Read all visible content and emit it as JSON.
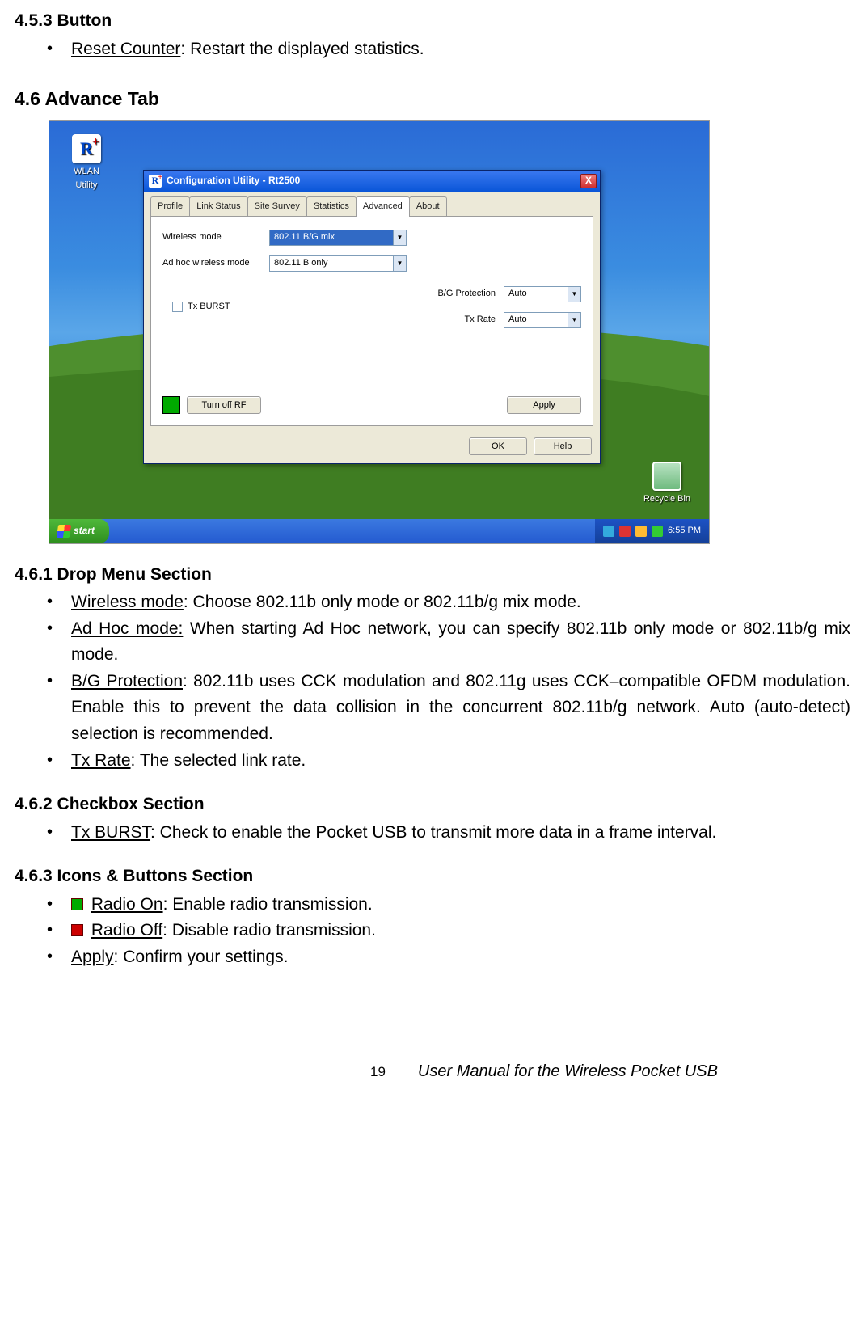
{
  "section_453": "4.5.3 Button",
  "bullet_453": {
    "term": "Reset Counter",
    "desc": ": Restart the displayed statistics."
  },
  "section_46": "4.6 Advance Tab",
  "desktop": {
    "shortcut_label": "WLAN Utility",
    "recycle_label": "Recycle Bin",
    "start_label": "start",
    "clock": "6:55 PM"
  },
  "dialog": {
    "title": "Configuration Utility - Rt2500",
    "close_glyph": "X",
    "tabs": [
      "Profile",
      "Link Status",
      "Site Survey",
      "Statistics",
      "Advanced",
      "About"
    ],
    "active_tab": "Advanced",
    "wireless_mode_label": "Wireless mode",
    "wireless_mode_value": "802.11 B/G mix",
    "adhoc_label": "Ad hoc wireless mode",
    "adhoc_value": "802.11 B only",
    "txburst_label": "Tx BURST",
    "bg_label": "B/G Protection",
    "bg_value": "Auto",
    "txrate_label": "Tx Rate",
    "txrate_value": "Auto",
    "turn_off_rf": "Turn off RF",
    "apply": "Apply",
    "ok": "OK",
    "help": "Help",
    "combo_arrow": "▼"
  },
  "section_461": "4.6.1 Drop Menu Section",
  "b461": {
    "wm_term": "Wireless mode",
    "wm_desc": ": Choose 802.11b only mode or 802.11b/g mix mode.",
    "ah_term": "Ad Hoc mode:",
    "ah_desc": " When starting Ad Hoc network, you can specify 802.11b only mode or 802.11b/g mix mode.",
    "bg_term": "B/G Protection",
    "bg_desc": ": 802.11b uses CCK modulation and 802.11g uses CCK–compatible OFDM modulation. Enable this to prevent the data collision in the concurrent 802.11b/g network. Auto (auto-detect) selection is recommended.",
    "tr_term": "Tx Rate",
    "tr_desc": ": The selected link rate."
  },
  "section_462": "4.6.2 Checkbox Section",
  "b462": {
    "term": "Tx BURST",
    "desc": ": Check to enable the Pocket USB to transmit more data in a frame interval."
  },
  "section_463": "4.6.3 Icons & Buttons Section",
  "b463": {
    "ron_term": "Radio On",
    "ron_desc": ": Enable radio transmission.",
    "roff_term": "Radio Off",
    "roff_desc": ": Disable radio transmission.",
    "apply_term": "Apply",
    "apply_desc": ": Confirm your settings."
  },
  "footer": {
    "page": "19",
    "title": "User Manual for the Wireless Pocket USB"
  }
}
